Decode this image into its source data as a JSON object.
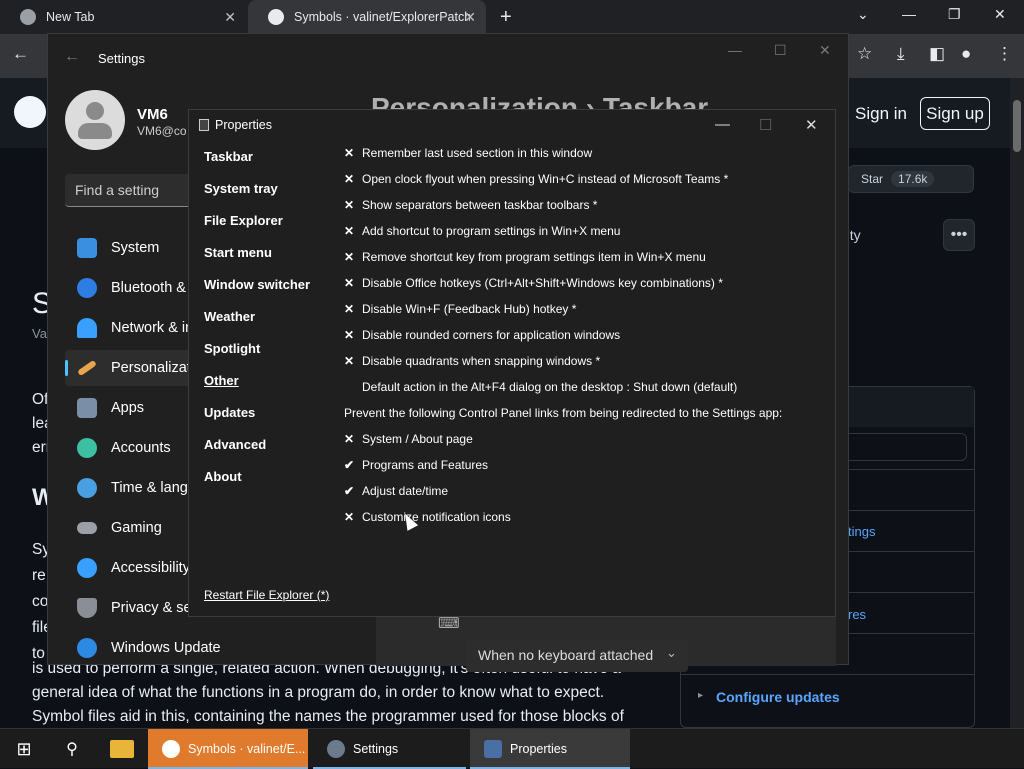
{
  "browser": {
    "tabs": [
      {
        "title": "New Tab",
        "close": "✕"
      },
      {
        "title": "Symbols · valinet/ExplorerPatcher",
        "close": "✕"
      }
    ],
    "new_tab": "+",
    "window_controls": {
      "minimize_tabsearch": "⌄",
      "minimize": "—",
      "restore": "❐",
      "close": "✕"
    }
  },
  "github": {
    "sign_in": "Sign in",
    "sign_up": "Sign up",
    "star_label": "Star",
    "star_count": "17.6k",
    "more": "•••",
    "partial_heading": "S",
    "partial_sub": "Va",
    "partial_ity": "rity",
    "partial_lines": [
      "Of",
      "lea",
      "err"
    ],
    "partial_w": "W",
    "partial_sy": [
      "Sy",
      "re",
      "co",
      "file",
      "to"
    ],
    "body_lines": [
      "is used to perform a single, related action. When debugging, it's often useful to have a",
      "general idea of what the functions in a program do, in order to know what to expect.",
      "Symbol files aid in this, containing the names the programmer used for those blocks of"
    ],
    "link_tings": "tings",
    "link_res": "res",
    "configure_updates": "Configure updates"
  },
  "settings": {
    "title": "Settings",
    "heading": "Personalization  ›  Taskbar",
    "user_name": "VM6",
    "user_email": "VM6@co",
    "search_placeholder": "Find a setting",
    "nav": [
      {
        "label": "System",
        "color": "#3b8fe0"
      },
      {
        "label": "Bluetooth & d",
        "color": "#2d7de2"
      },
      {
        "label": "Network & in",
        "color": "#3aa0ff"
      },
      {
        "label": "Personalizatio",
        "color": "#e8a54b"
      },
      {
        "label": "Apps",
        "color": "#7a8ea8"
      },
      {
        "label": "Accounts",
        "color": "#3dbfa3"
      },
      {
        "label": "Time & langu",
        "color": "#4a9fe0"
      },
      {
        "label": "Gaming",
        "color": "#9aa0a6"
      },
      {
        "label": "Accessibility",
        "color": "#3aa0ff"
      },
      {
        "label": "Privacy & sec",
        "color": "#8a8f96"
      },
      {
        "label": "Windows Update",
        "color": "#2d8ae2"
      }
    ],
    "keyboard_select": "When no keyboard attached",
    "keyboard_chevron": "⌄"
  },
  "properties": {
    "title": "Properties",
    "sidebar": [
      "Taskbar",
      "System tray",
      "File Explorer",
      "Start menu",
      "Window switcher",
      "Weather",
      "Spotlight",
      "Other",
      "Updates",
      "Advanced",
      "About"
    ],
    "current_section": "Other",
    "options": [
      {
        "mark": "✕",
        "label": "Remember last used section in this window"
      },
      {
        "mark": "✕",
        "label": "Open clock flyout when pressing Win+C instead of Microsoft Teams *"
      },
      {
        "mark": "✕",
        "label": "Show separators between taskbar toolbars *"
      },
      {
        "mark": "✕",
        "label": "Add shortcut to program settings in Win+X menu"
      },
      {
        "mark": "✕",
        "label": "Remove shortcut key from program settings item in Win+X menu"
      },
      {
        "mark": "✕",
        "label": "Disable Office hotkeys (Ctrl+Alt+Shift+Windows key combinations) *"
      },
      {
        "mark": "✕",
        "label": "Disable Win+F (Feedback Hub) hotkey *"
      },
      {
        "mark": "✕",
        "label": "Disable rounded corners for application windows"
      },
      {
        "mark": "✕",
        "label": "Disable quadrants when snapping windows *"
      }
    ],
    "default_action": "Default action in the Alt+F4 dialog on the desktop : Shut down (default)",
    "redirect_heading": "Prevent the following Control Panel links from being redirected to the Settings app:",
    "redirect_options": [
      {
        "mark": "✕",
        "label": "System / About page"
      },
      {
        "mark": "✔",
        "label": "Programs and Features"
      },
      {
        "mark": "✔",
        "label": "Adjust date/time"
      },
      {
        "mark": "✕",
        "label": "Customize notification icons"
      }
    ],
    "restart": "Restart File Explorer (*)",
    "window_controls": {
      "minimize": "—",
      "maximize": "☐",
      "close": "✕"
    }
  },
  "taskbar": {
    "items": [
      {
        "label": "Symbols · valinet/E...",
        "color": "#e07a2c"
      },
      {
        "label": "Settings",
        "color": "#6b7b8c"
      },
      {
        "label": "Properties",
        "color": "#4a6fa5"
      }
    ]
  }
}
